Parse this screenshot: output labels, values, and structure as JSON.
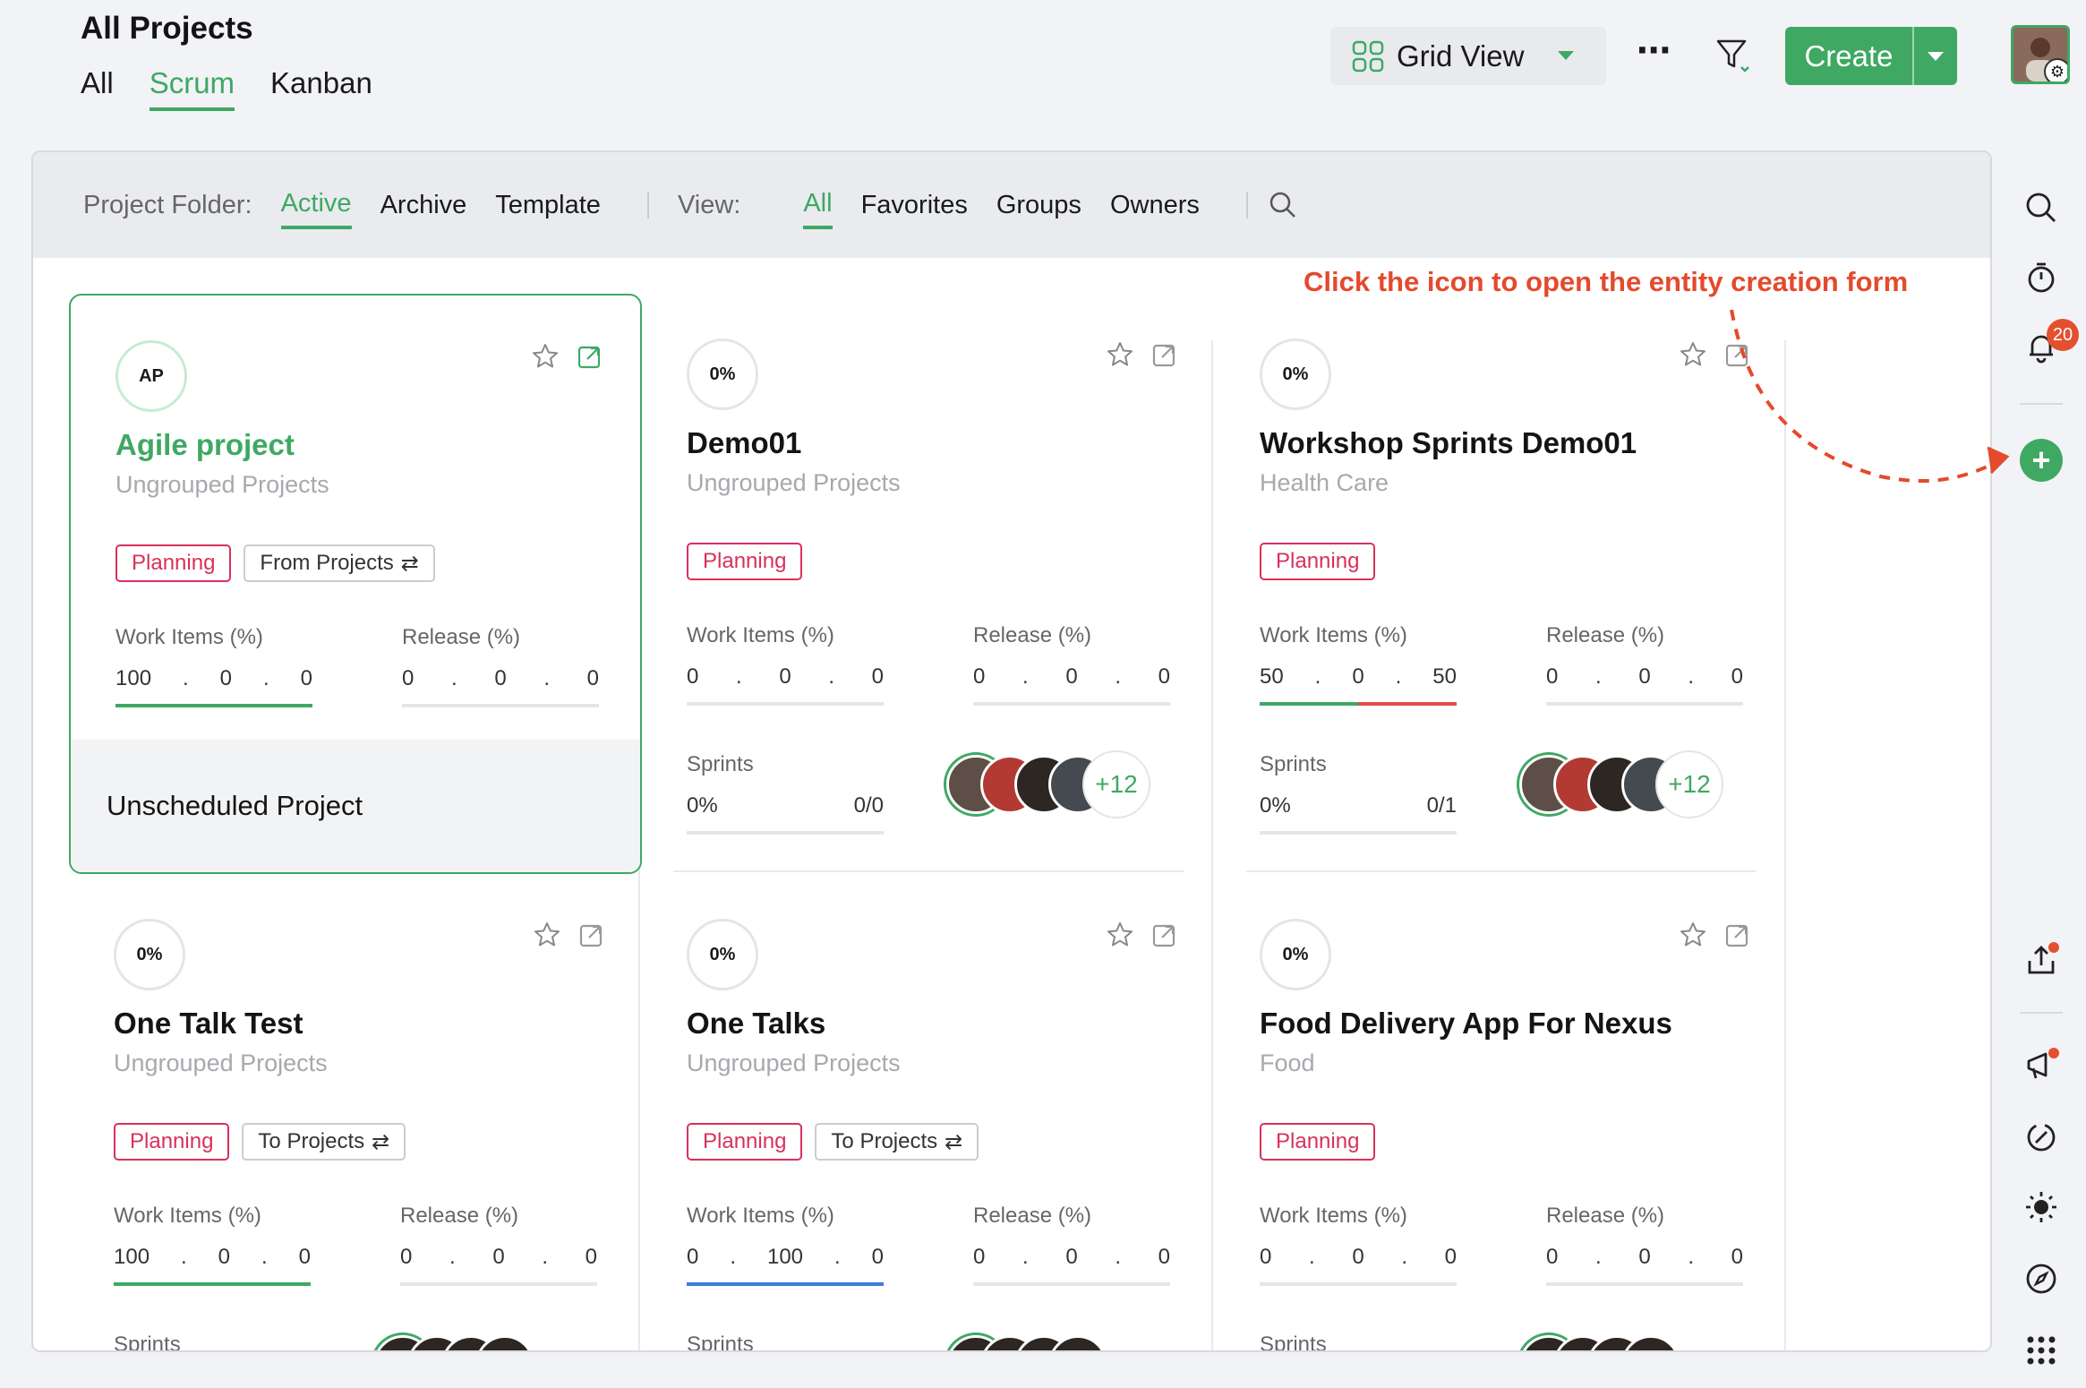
{
  "header": {
    "title": "All Projects",
    "tabs": [
      {
        "label": "All",
        "active": false
      },
      {
        "label": "Scrum",
        "active": true
      },
      {
        "label": "Kanban",
        "active": false
      }
    ],
    "view_label": "Grid View",
    "create_label": "Create",
    "more_label": "⋯"
  },
  "toolbar": {
    "folder_label": "Project Folder:",
    "folders": [
      "Active",
      "Archive",
      "Template"
    ],
    "view_label": "View:",
    "views": [
      "All",
      "Favorites",
      "Groups",
      "Owners"
    ]
  },
  "annotation": "Click the icon to open the entity creation form",
  "colors": {
    "accent": "#3fa863",
    "planning": "#d8315b",
    "annotation": "#e44a2c",
    "bar_green": "#3fa863",
    "bar_red": "#e34a4a",
    "bar_blue": "#3d7be0"
  },
  "labels": {
    "work_items": "Work Items (%)",
    "release": "Release (%)",
    "sprints": "Sprints",
    "unscheduled": "Unscheduled Project"
  },
  "cards": [
    {
      "badge": "AP",
      "name": "Agile project",
      "group": "Ungrouped Projects",
      "status": "Planning",
      "flow": "From Projects",
      "work": [
        "100",
        ".",
        "0",
        ".",
        "0"
      ],
      "release": [
        "0",
        ".",
        "0",
        ".",
        "0"
      ]
    },
    {
      "badge": "0%",
      "name": "Demo01",
      "group": "Ungrouped Projects",
      "status": "Planning",
      "work": [
        "0",
        ".",
        "0",
        ".",
        "0"
      ],
      "release": [
        "0",
        ".",
        "0",
        ".",
        "0"
      ],
      "sprint_pct": "0%",
      "sprint_count": "0/0",
      "more_members": "+12"
    },
    {
      "badge": "0%",
      "name": "Workshop Sprints Demo01",
      "group": "Health Care",
      "status": "Planning",
      "work": [
        "50",
        ".",
        "0",
        ".",
        "50"
      ],
      "release": [
        "0",
        ".",
        "0",
        ".",
        "0"
      ],
      "sprint_pct": "0%",
      "sprint_count": "0/1",
      "more_members": "+12"
    },
    {
      "badge": "0%",
      "name": "One Talk Test",
      "group": "Ungrouped Projects",
      "status": "Planning",
      "flow": "To Projects",
      "work": [
        "100",
        ".",
        "0",
        ".",
        "0"
      ],
      "release": [
        "0",
        ".",
        "0",
        ".",
        "0"
      ]
    },
    {
      "badge": "0%",
      "name": "One Talks",
      "group": "Ungrouped Projects",
      "status": "Planning",
      "flow": "To Projects",
      "work": [
        "0",
        ".",
        "100",
        ".",
        "0"
      ],
      "release": [
        "0",
        ".",
        "0",
        ".",
        "0"
      ]
    },
    {
      "badge": "0%",
      "name": "Food Delivery App For Nexus",
      "group": "Food",
      "status": "Planning",
      "work": [
        "0",
        ".",
        "0",
        ".",
        "0"
      ],
      "release": [
        "0",
        ".",
        "0",
        ".",
        "0"
      ]
    }
  ],
  "rail": {
    "notification_count": "20"
  }
}
